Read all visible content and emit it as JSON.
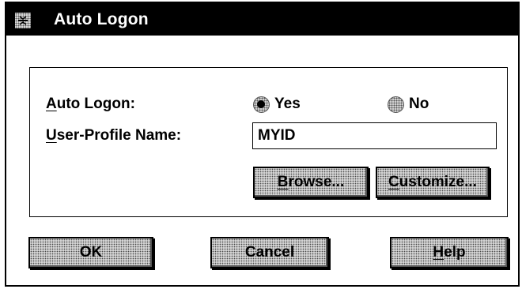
{
  "dialog": {
    "title": "Auto Logon",
    "sysmenu_icon": "window-menu-icon"
  },
  "form": {
    "auto_logon_label_mn": "A",
    "auto_logon_label_rest": "uto Logon:",
    "yes_label": "Yes",
    "no_label": "No",
    "selected": "Yes",
    "profile_label_mn": "U",
    "profile_label_rest": "ser-Profile Name:",
    "profile_value": "MYID"
  },
  "buttons": {
    "browse_mn": "B",
    "browse_rest": "rowse...",
    "customize_mn": "C",
    "customize_rest": "ustomize...",
    "ok": "OK",
    "cancel": "Cancel",
    "help_mn": "H",
    "help_rest": "elp"
  }
}
